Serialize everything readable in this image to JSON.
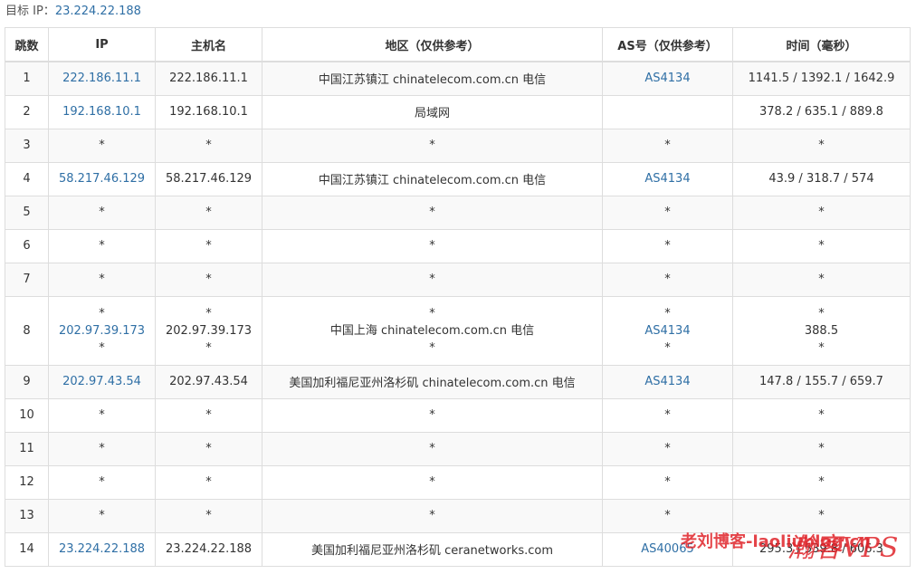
{
  "target": {
    "label": "目标 IP：",
    "ip": "23.224.22.188"
  },
  "columns": [
    "跳数",
    "IP",
    "主机名",
    "地区（仅供参考）",
    "AS号（仅供参考）",
    "时间（毫秒）"
  ],
  "rows": [
    {
      "hop": "1",
      "ip": "222.186.11.1",
      "host": "222.186.11.1",
      "region": "中国江苏镇江 chinatelecom.com.cn 电信",
      "as": "AS4134",
      "time": "1141.5 / 1392.1 / 1642.9"
    },
    {
      "hop": "2",
      "ip": "192.168.10.1",
      "host": "192.168.10.1",
      "region": "局域网",
      "as": "",
      "time": "378.2 / 635.1 / 889.8"
    },
    {
      "hop": "3",
      "ip": "*",
      "host": "*",
      "region": "*",
      "as": "*",
      "time": "*"
    },
    {
      "hop": "4",
      "ip": "58.217.46.129",
      "host": "58.217.46.129",
      "region": "中国江苏镇江 chinatelecom.com.cn 电信",
      "as": "AS4134",
      "time": "43.9 / 318.7 / 574"
    },
    {
      "hop": "5",
      "ip": "*",
      "host": "*",
      "region": "*",
      "as": "*",
      "time": "*"
    },
    {
      "hop": "6",
      "ip": "*",
      "host": "*",
      "region": "*",
      "as": "*",
      "time": "*"
    },
    {
      "hop": "7",
      "ip": "*",
      "host": "*",
      "region": "*",
      "as": "*",
      "time": "*"
    },
    {
      "hop": "8",
      "ip_lines": [
        "*",
        "202.97.39.173",
        "*"
      ],
      "host_lines": [
        "*",
        "202.97.39.173",
        "*"
      ],
      "region_lines": [
        "*",
        "中国上海 chinatelecom.com.cn 电信",
        "*"
      ],
      "as_lines": [
        "*",
        "AS4134",
        "*"
      ],
      "time_lines": [
        "*",
        "388.5",
        "*"
      ]
    },
    {
      "hop": "9",
      "ip": "202.97.43.54",
      "host": "202.97.43.54",
      "region": "美国加利福尼亚州洛杉矶 chinatelecom.com.cn 电信",
      "as": "AS4134",
      "time": "147.8 / 155.7 / 659.7"
    },
    {
      "hop": "10",
      "ip": "*",
      "host": "*",
      "region": "*",
      "as": "*",
      "time": "*"
    },
    {
      "hop": "11",
      "ip": "*",
      "host": "*",
      "region": "*",
      "as": "*",
      "time": "*"
    },
    {
      "hop": "12",
      "ip": "*",
      "host": "*",
      "region": "*",
      "as": "*",
      "time": "*"
    },
    {
      "hop": "13",
      "ip": "*",
      "host": "*",
      "region": "*",
      "as": "*",
      "time": "*"
    },
    {
      "hop": "14",
      "ip": "23.224.22.188",
      "host": "23.224.22.188",
      "region": "美国加利福尼亚州洛杉矶 ceranetworks.com",
      "as": "AS40065",
      "time": "295.3 / 539.8 / 606.3"
    }
  ],
  "watermark": {
    "text1": "老刘博客-laoliublog.cn",
    "text2": "瀚客VPS"
  },
  "colors": {
    "link": "#2f6fa5",
    "border": "#dddddd",
    "stripe": "#f9f9f9",
    "watermark": "#e0242a"
  }
}
